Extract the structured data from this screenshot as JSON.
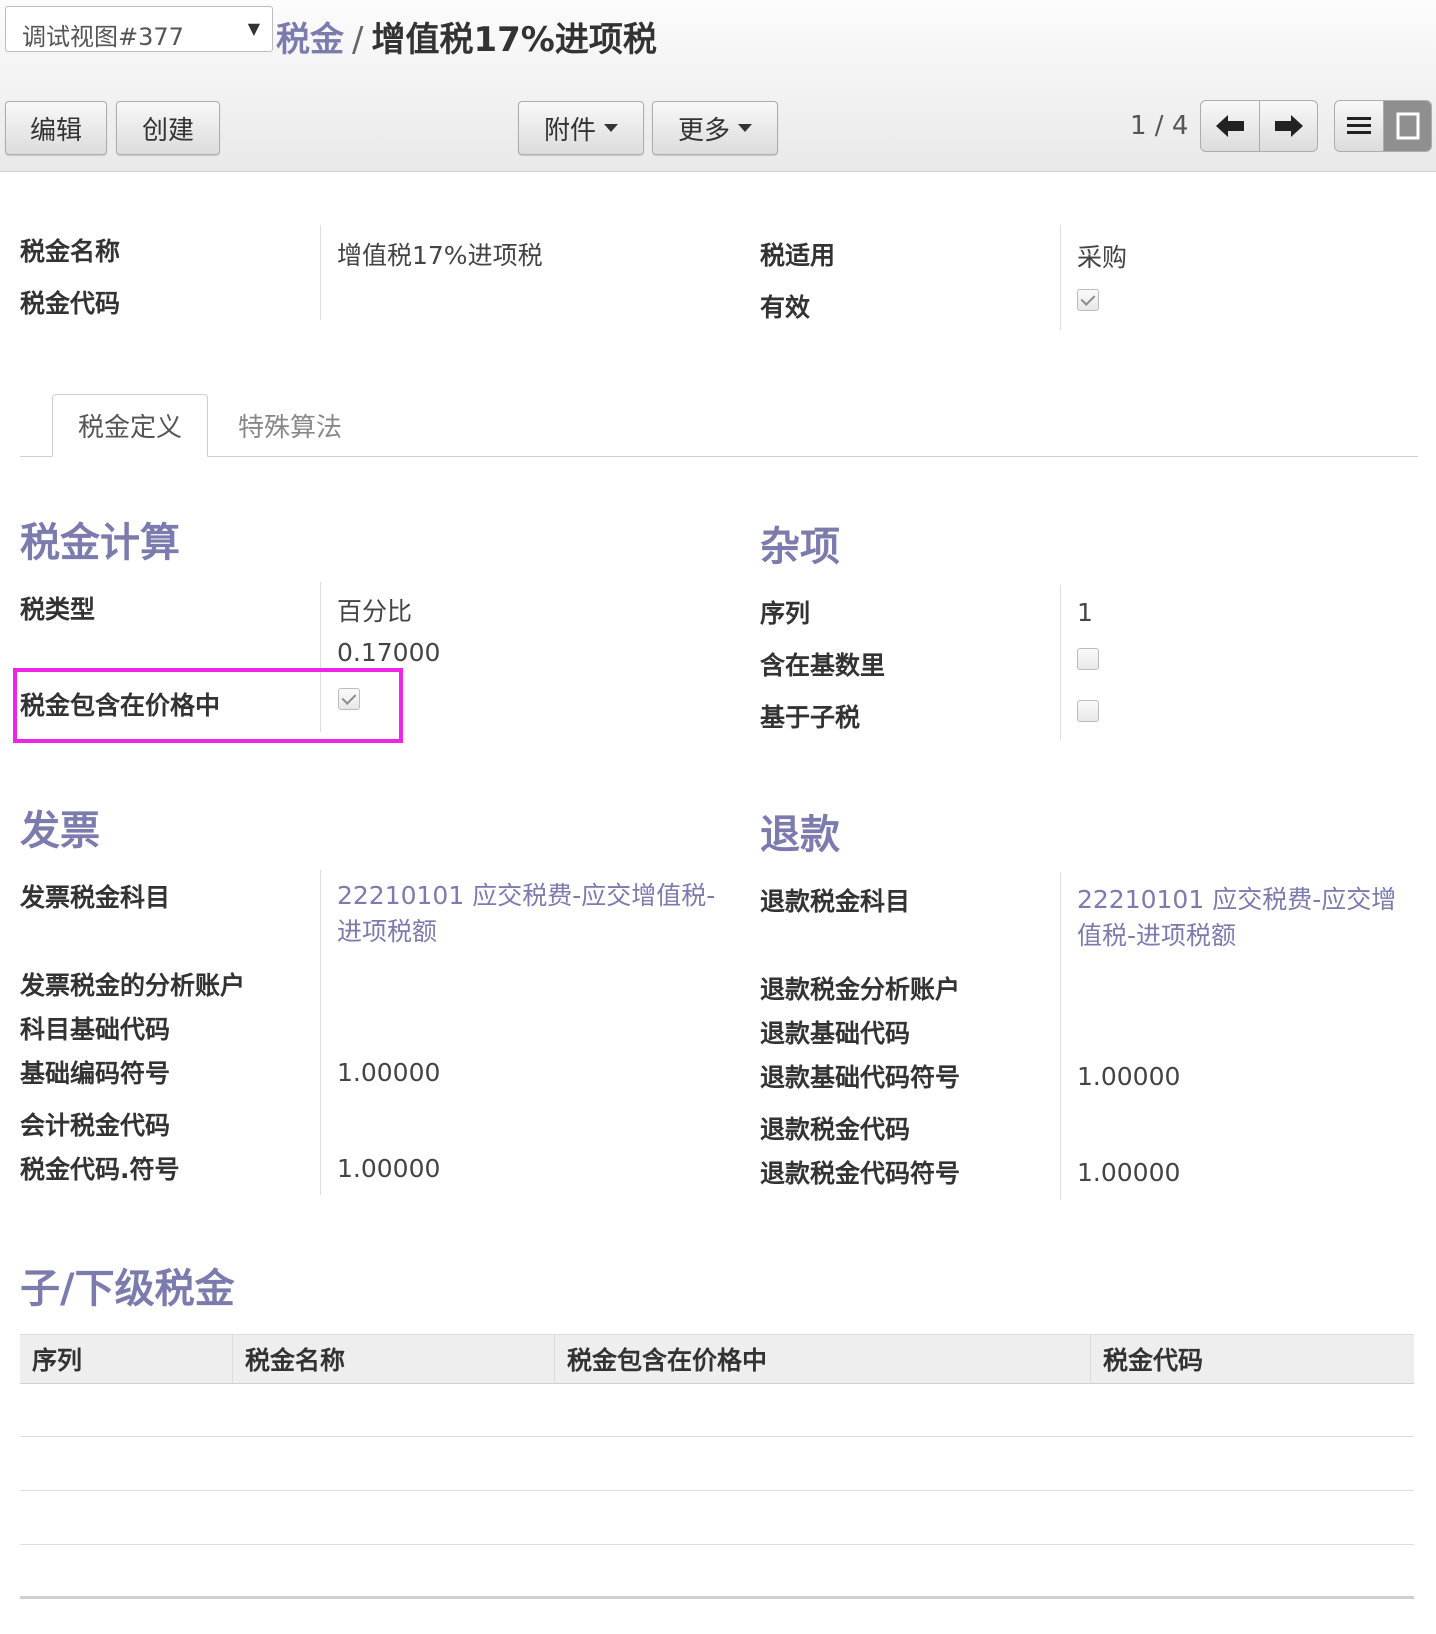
{
  "toolbar": {
    "view_select": "调试视图#377",
    "breadcrumb_parent": "税金",
    "breadcrumb_separator": "/",
    "breadcrumb_current": "增值税17%进项税",
    "edit_label": "编辑",
    "create_label": "创建",
    "attachments_label": "附件",
    "more_label": "更多",
    "pager": "1 / 4"
  },
  "header_fields": {
    "tax_name_label": "税金名称",
    "tax_name_value": "增值税17%进项税",
    "tax_code_label": "税金代码",
    "tax_code_value": "",
    "tax_scope_label": "税适用",
    "tax_scope_value": "采购",
    "active_label": "有效",
    "active_checked": true
  },
  "tabs": [
    {
      "label": "税金定义",
      "active": true
    },
    {
      "label": "特殊算法",
      "active": false
    }
  ],
  "tax_computation": {
    "title": "税金计算",
    "type_label": "税类型",
    "type_value": "百分比",
    "amount_value": "0.17000",
    "price_include_label": "税金包含在价格中",
    "price_include_checked": true
  },
  "misc": {
    "title": "杂项",
    "sequence_label": "序列",
    "sequence_value": "1",
    "include_base_label": "含在基数里",
    "include_base_checked": false,
    "child_depend_label": "基于子税",
    "child_depend_checked": false
  },
  "invoices": {
    "title": "发票",
    "account_label": "发票税金科目",
    "account_value": "22210101 应交税费-应交增值税-进项税额",
    "analytic_label": "发票税金的分析账户",
    "base_code_label": "科目基础代码",
    "base_sign_label": "基础编码符号",
    "base_sign_value": "1.00000",
    "tax_code_label": "会计税金代码",
    "tax_sign_label": "税金代码.符号",
    "tax_sign_value": "1.00000"
  },
  "refunds": {
    "title": "退款",
    "account_label": "退款税金科目",
    "account_value": "22210101 应交税费-应交增值税-进项税额",
    "analytic_label": "退款税金分析账户",
    "base_code_label": "退款基础代码",
    "base_sign_label": "退款基础代码符号",
    "base_sign_value": "1.00000",
    "tax_code_label": "退款税金代码",
    "tax_sign_label": "退款税金代码符号",
    "tax_sign_value": "1.00000"
  },
  "children": {
    "title": "子/下级税金",
    "columns": [
      "序列",
      "税金名称",
      "税金包含在价格中",
      "税金代码"
    ]
  },
  "colors": {
    "accent": "#7c7bad",
    "highlight": "#ee24e8"
  }
}
